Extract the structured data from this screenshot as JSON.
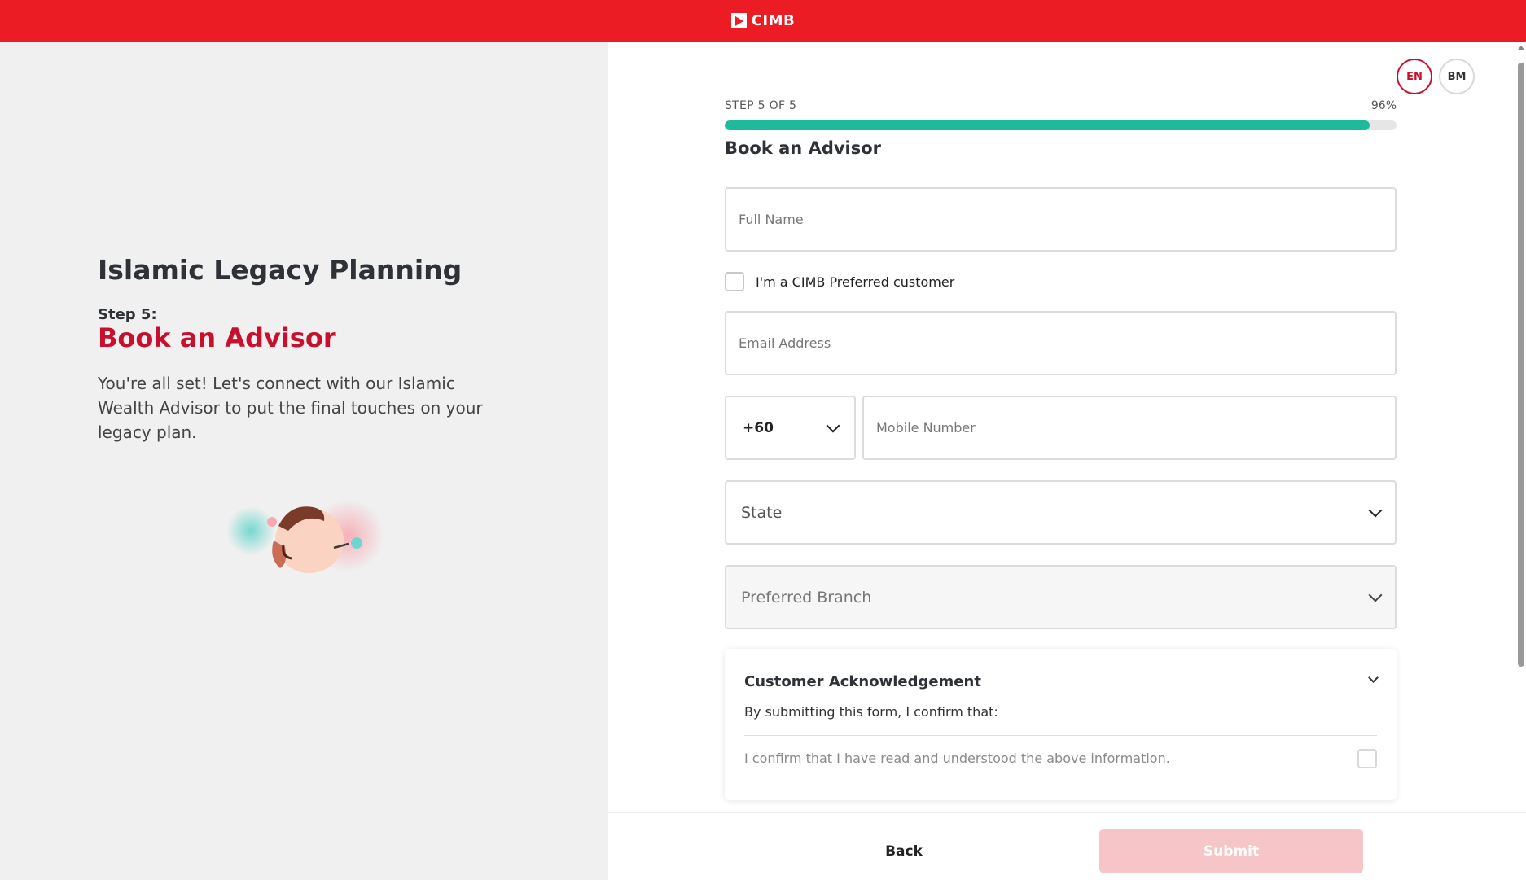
{
  "header": {
    "brand": "CIMB",
    "accent": "#ec1c24"
  },
  "left": {
    "title": "Islamic Legacy Planning",
    "step_label": "Step 5:",
    "heading": "Book an Advisor",
    "description": "You're all set! Let's connect with our Islamic Wealth Advisor to put the final touches on your legacy plan."
  },
  "lang": {
    "en": "EN",
    "bm": "BM",
    "active": "EN"
  },
  "progress": {
    "step_text": "STEP 5 OF 5",
    "percent_text": "96%",
    "value": 0.96,
    "fill_color": "#1fba9c"
  },
  "form": {
    "title": "Book an Advisor",
    "full_name": {
      "placeholder": "Full Name",
      "value": ""
    },
    "preferred_customer_label": "I'm a CIMB Preferred customer",
    "email": {
      "placeholder": "Email Address",
      "value": ""
    },
    "country_code": "+60",
    "mobile": {
      "placeholder": "Mobile Number",
      "value": ""
    },
    "state_placeholder": "State",
    "branch_placeholder": "Preferred Branch"
  },
  "acknowledgement": {
    "title": "Customer Acknowledgement",
    "subtitle": "By submitting this form, I confirm that:",
    "confirm_text": "I confirm that I have read and understood the above information."
  },
  "footer": {
    "back_label": "Back",
    "submit_label": "Submit",
    "submit_color": "#f6c5c8"
  }
}
